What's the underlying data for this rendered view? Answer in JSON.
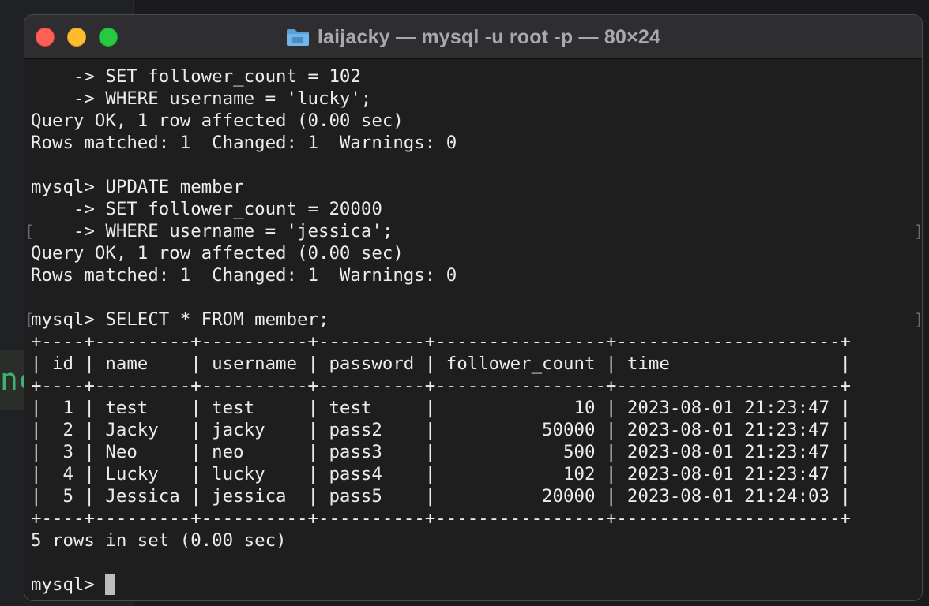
{
  "window": {
    "title": "laijacky — mysql -u root -p — 80×24",
    "folder_icon": "folder-icon",
    "colors": {
      "close": "#fe5f57",
      "minimize": "#febc2e",
      "zoom": "#28c840",
      "background": "#1e1e1e",
      "text": "#ececec"
    }
  },
  "terminal": {
    "lines": [
      "    -> SET follower_count = 102",
      "    -> WHERE username = 'lucky';",
      "Query OK, 1 row affected (0.00 sec)",
      "Rows matched: 1  Changed: 1  Warnings: 0",
      "",
      "mysql> UPDATE member",
      "    -> SET follower_count = 20000",
      "    -> WHERE username = 'jessica';",
      "Query OK, 1 row affected (0.00 sec)",
      "Rows matched: 1  Changed: 1  Warnings: 0",
      "",
      "mysql> SELECT * FROM member;",
      "+----+---------+----------+----------+----------------+---------------------+",
      "| id | name    | username | password | follower_count | time                |",
      "+----+---------+----------+----------+----------------+---------------------+",
      "|  1 | test    | test     | test     |             10 | 2023-08-01 21:23:47 |",
      "|  2 | Jacky   | jacky    | pass2    |          50000 | 2023-08-01 21:23:47 |",
      "|  3 | Neo     | neo      | pass3    |            500 | 2023-08-01 21:23:47 |",
      "|  4 | Lucky   | lucky    | pass4    |            102 | 2023-08-01 21:23:47 |",
      "|  5 | Jessica | jessica  | pass5    |          20000 | 2023-08-01 21:24:03 |",
      "+----+---------+----------+----------+----------------+---------------------+",
      "5 rows in set (0.00 sec)",
      "",
      "mysql> "
    ],
    "prompt": "mysql> "
  },
  "background": {
    "peek_text": "nc"
  }
}
